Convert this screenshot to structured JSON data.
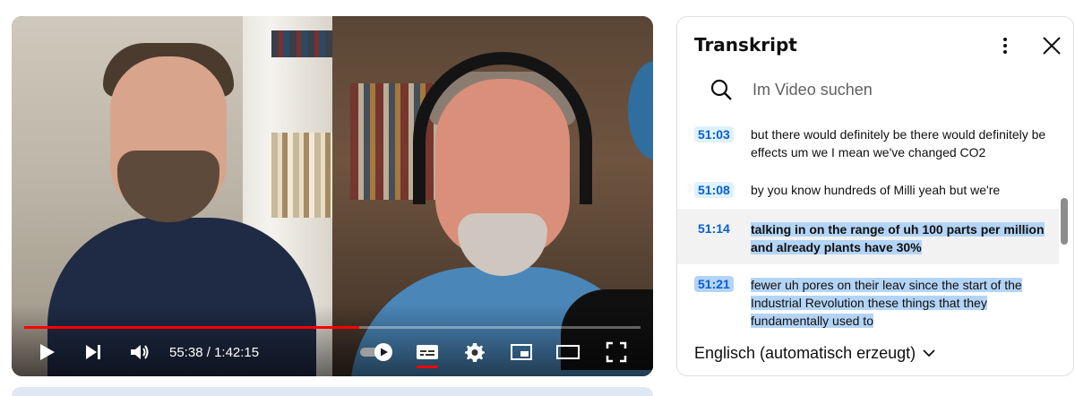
{
  "player": {
    "current_time": "55:38",
    "duration": "1:42:15",
    "time_separator": " / ",
    "progress": 0.544,
    "accent_color": "#ff0000",
    "controls": [
      "play-icon",
      "next-icon",
      "volume-icon",
      "autoplay-toggle-icon",
      "subtitles-icon",
      "settings-icon",
      "miniplayer-icon",
      "theater-mode-icon",
      "fullscreen-icon"
    ]
  },
  "transcript": {
    "title": "Transkript",
    "search_placeholder": "Im Video suchen",
    "segments": [
      {
        "timestamp": "51:03",
        "text": "but there would definitely be there would definitely be effects um we I mean we've changed CO2",
        "active": false,
        "highlighted": false
      },
      {
        "timestamp": "51:08",
        "text": "by you know hundreds of Milli yeah but we're",
        "active": false,
        "highlighted": false
      },
      {
        "timestamp": "51:14",
        "text": "talking in on the range of uh 100 parts per million and already plants have 30%",
        "active": true,
        "highlighted": true
      },
      {
        "timestamp": "51:21",
        "text": "fewer uh pores on their leav since the start of the Industrial Revolution these things that they fundamentally used to",
        "active": false,
        "highlighted": true
      }
    ],
    "language": "Englisch (automatisch erzeugt)",
    "timestamp_color": "#065fd4",
    "timestamp_bg": "#def1ff",
    "highlight_color": "#b3d4f5"
  }
}
